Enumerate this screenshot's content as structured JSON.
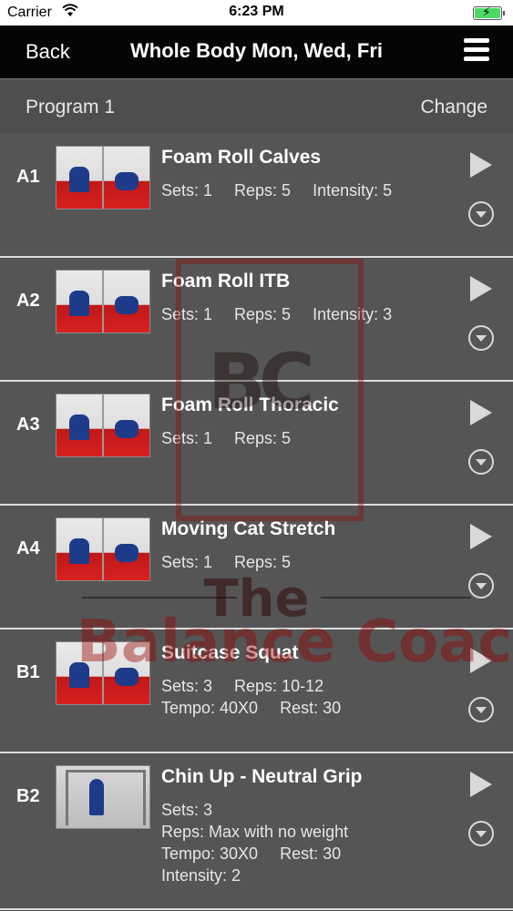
{
  "status_bar": {
    "carrier": "Carrier",
    "time": "6:23 PM",
    "wifi_icon": "wifi-icon",
    "battery_icon": "battery-charging-icon"
  },
  "navbar": {
    "back_label": "Back",
    "title": "Whole Body Mon, Wed, Fri",
    "menu_icon": "hamburger-menu-icon"
  },
  "program": {
    "name": "Program 1",
    "change_label": "Change"
  },
  "exercises": [
    {
      "code": "A1",
      "name": "Foam Roll Calves",
      "line1": "Sets: 1",
      "line2": "Reps: 5",
      "line3": "Intensity: 5"
    },
    {
      "code": "A2",
      "name": "Foam Roll ITB",
      "line1": "Sets: 1",
      "line2": "Reps: 5",
      "line3": "Intensity: 3"
    },
    {
      "code": "A3",
      "name": "Foam Roll Thoracic",
      "line1": "Sets: 1",
      "line2": "Reps: 5"
    },
    {
      "code": "A4",
      "name": "Moving Cat Stretch",
      "line1": "Sets: 1",
      "line2": "Reps: 5"
    },
    {
      "code": "B1",
      "name": "Suitcase Squat",
      "line1": "Sets: 3",
      "line2": "Reps: 10-12",
      "line3": "Tempo: 40X0",
      "line4": "Rest: 30"
    },
    {
      "code": "B2",
      "name": "Chin Up - Neutral Grip",
      "line1": "Sets: 3",
      "line2": "Reps: Max with no weight",
      "line3": "Tempo: 30X0",
      "line4": "Rest: 30",
      "line5": "Intensity: 2"
    }
  ],
  "watermark": {
    "logo_text": "BC",
    "the": "The",
    "brand": "Balance Coach"
  },
  "colors": {
    "navbar_bg": "#050505",
    "row_bg": "#555555",
    "separator": "#dcdcdc",
    "watermark_red": "#960000"
  }
}
